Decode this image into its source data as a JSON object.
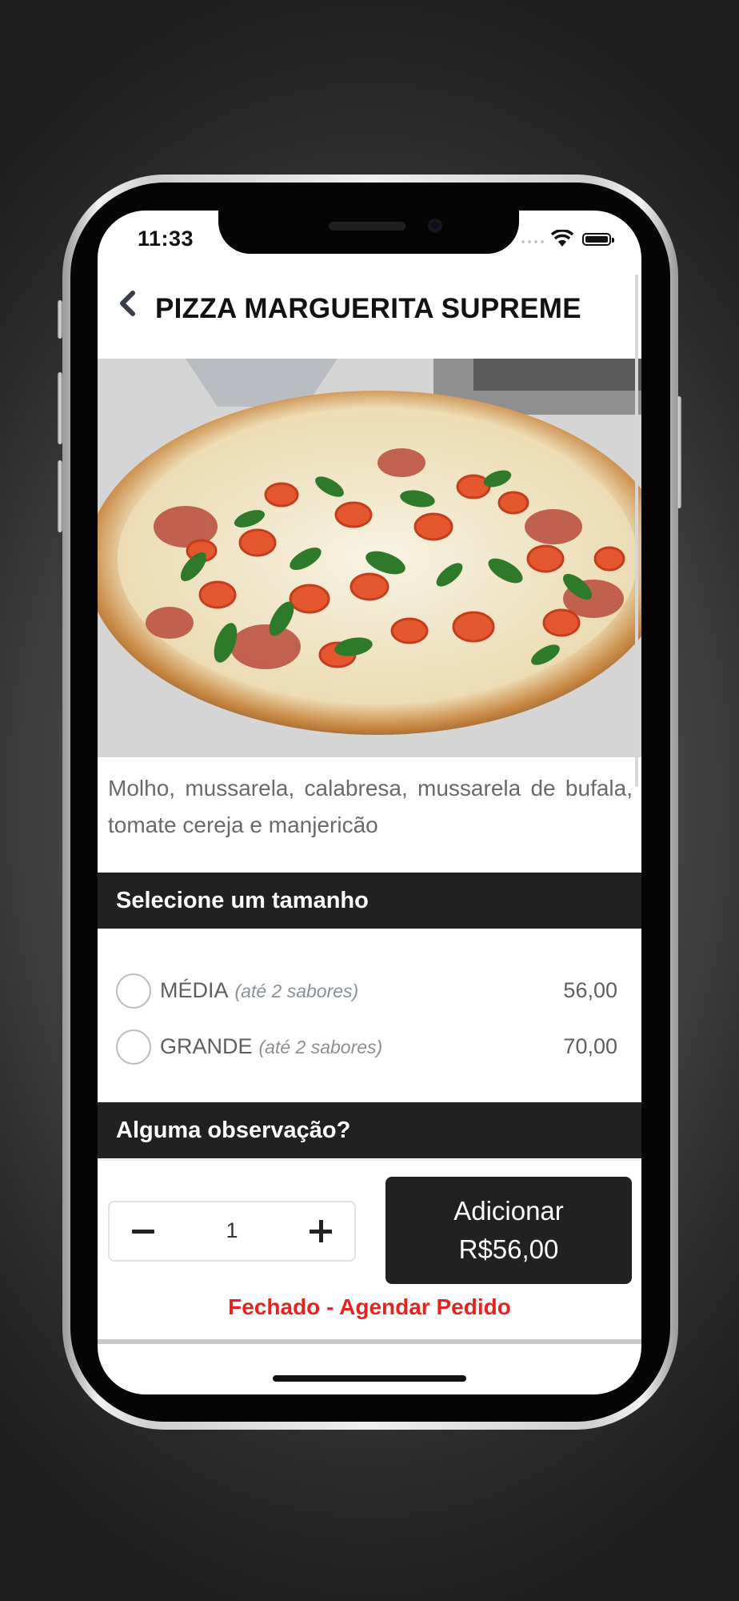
{
  "status_bar": {
    "time": "11:33"
  },
  "header": {
    "title": "PIZZA MARGUERITA SUPREME"
  },
  "product": {
    "description": "Molho, mussarela, calabresa, mussarela de bufala, tomate cereja e manjericão"
  },
  "size_section": {
    "title": "Selecione um tamanho",
    "options": [
      {
        "name": "MÉDIA",
        "note": "(até 2 sabores)",
        "price": "56,00"
      },
      {
        "name": "GRANDE",
        "note": "(até 2 sabores)",
        "price": "70,00"
      }
    ]
  },
  "notes_section": {
    "title": "Alguma observação?"
  },
  "footer": {
    "quantity": "1",
    "add_label": "Adicionar",
    "add_price": "R$56,00",
    "status": "Fechado - Agendar Pedido"
  },
  "colors": {
    "dark_bar": "#212121",
    "closed_red": "#e8231f"
  }
}
